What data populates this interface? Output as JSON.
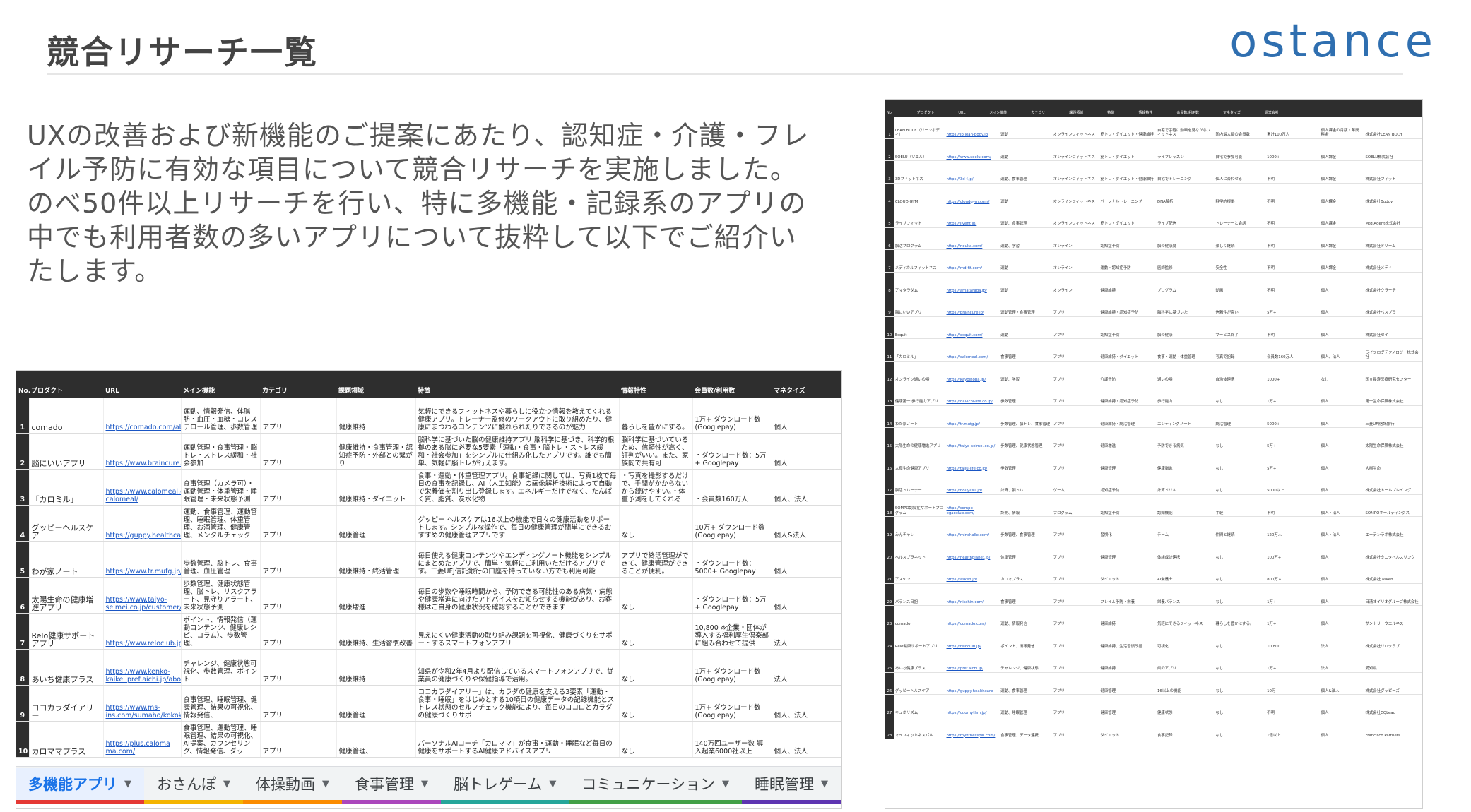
{
  "slide": {
    "title": "競合リサーチ一覧",
    "logo": "ostance",
    "intro_lines": [
      "UXの改善および新機能のご提案にあたり、認知症・介護・フレ",
      "イル予防に有効な項目について競合リサーチを実施しました。",
      "のべ50件以上リサーチを行い、特に多機能・記録系のアプリの",
      "中でも利用者数の多いアプリについて抜粋して以下でご紹介い",
      "たします。"
    ]
  },
  "sheet": {
    "headers": [
      "No.",
      "プロダクト",
      "URL",
      "メイン機能",
      "カテゴリ",
      "課題領域",
      "特徴",
      "情報特性",
      "会員数/利用数",
      "マネタイズ"
    ],
    "rows": [
      {
        "no": "1",
        "product": "comado",
        "url": "https://comado.com/about.app",
        "main": "運動、情報発信、体脂肪・血圧・血糖・コレステロール管理、歩数管理",
        "category": "アプリ",
        "area": "健康維持",
        "feature": "気軽にできるフィットネスや暮らしに役立つ情報を教えてくれる健康アプリ。トレーナー監修のワークアウトに取り組めたり、健康にまつわるコンテンツに触れられたりできるのが魅力",
        "info": "暮らしを豊かにする。",
        "users": "1万+ ダウンロード数 (Googlepay)",
        "money": "個人"
      },
      {
        "no": "2",
        "product": "脳にいいアプリ",
        "url": "https://www.braincure.jp/",
        "main": "運動管理・食事管理・脳トレ・ストレス緩和・社会参加",
        "category": "アプリ",
        "area": "健康維持・食事管理・認知症予防・外部との繋がり",
        "feature": "脳科学に基づいた脳の健康維持アプリ 脳科学に基づき、科学的根拠のある脳に必要な5要素「運動・食事・脳トレ・ストレス緩和・社会参加」をシンプルに仕組み化したアプリです。誰でも簡単、気軽に脳トレが行えます。",
        "info": "脳科学に基づいているため、信頼性が高く、評判がいい。また、家族間で共有可",
        "users": "・ダウンロード数：5万+ Googlepay",
        "money": "個人"
      },
      {
        "no": "3",
        "product": "「カロミル」",
        "url": "https://www.calomeal.com/about-calomeal/",
        "main": "食事管理（カメラ可）・運動管理・体重管理・睡眠管理・未来状態予測",
        "category": "アプリ",
        "area": "健康維持・ダイエット",
        "feature": "食事・運動・体重管理アプリ。食事記録に関しては、写真1枚で毎日の食事を記録し、AI（人工知能）の画像解析技術によって自動で栄養価を割り出し登録します。エネルギーだけでなく、たんぱく質、脂質、炭水化物",
        "info": "・写真を撮影するだけで、手間がかからないから続けやすい。・体重予測をしてくれる",
        "users": "・会員数160万人",
        "money": "個人、法人"
      },
      {
        "no": "4",
        "product": "グッピーヘルスケア",
        "url": "https://guppy.healthcare",
        "main": "運動、食事管理、運動管理、睡眠管理、体重管理、お酒管理、健康管理、メンタルチェック",
        "category": "アプリ",
        "area": "健康管理",
        "feature": "グッピー ヘルスケアは16以上の機能で日々の健康活動をサポートします。シンプルな操作で、毎日の健康管理が簡単にできるおすすめの健康管理アプリです",
        "info": "なし",
        "users": "10万+ ダウンロード数 (Googlepay)",
        "money": "個人&法人"
      },
      {
        "no": "5",
        "product": "わが家ノート",
        "url": "https://www.tr.mufg.jp/ippan/wagayanote/health/",
        "main": "歩数管理、脳トレ、食事管理、血圧管理",
        "category": "アプリ",
        "area": "健康維持・終活管理",
        "feature": "毎日使える健康コンテンツやエンディングノート機能をシンプルにまとめたアプリで、簡単・気軽にご利用いただけるアプリです。三菱UFJ信託銀行の口座を持っていない方でも利用可能",
        "info": "アプリで終活管理ができて、健康管理ができることが便利。",
        "users": "・ダウンロード数：5000+ Googlepay",
        "money": "個人"
      },
      {
        "no": "6",
        "product": "太陽生命の健康増進アプリ",
        "url": "https://www.taiyo-seimei.co.jp/customer/health_promotion/app.html",
        "main": "歩数管理、健康状態管理、脳トレ、リスクアラート、見守りアラート、未来状態予測",
        "category": "アプリ",
        "area": "健康増進",
        "feature": "毎日の歩数や睡眠時間から、予防できる可能性のある病気・病態や健康増進に向けたアドバイスをお知らせする機能があり、お客様はご自身の健康状況を確認することができます",
        "info": "なし",
        "users": "・ダウンロード数：5万+ Googlepay",
        "money": "個人"
      },
      {
        "no": "7",
        "product": "Relo健康サポートアプリ",
        "url": "https://www.reloclub.jp/health/app/",
        "main": "ポイント、情報発信（運動コンテンツ、健康レシピ、コラム）、歩数管理、",
        "category": "アプリ",
        "area": "健康維持、生活習慣改善",
        "feature": "見えにくい健康活動の取り組み課題を可視化、健康づくりをサポートするスマートフォンアプリ",
        "info": "なし",
        "users": "10,800 ※企業・団体が導入する福利厚生倶楽部に組み合わせて提供",
        "money": "法人"
      },
      {
        "no": "8",
        "product": "あいち健康プラス",
        "url": "https://www.kenko-kaikei.pref.aichi.jp/about/app/",
        "main": "チャレンジ、健康状態可視化、歩数管理、ポイント",
        "category": "アプリ",
        "area": "健康維持",
        "feature": "知県が令和2年4月より配信しているスマートフォンアプリで、従業員の健康づくりや保健指導で活用。",
        "info": "なし",
        "users": "1万+ ダウンロード数 (Googlepay)",
        "money": "法人"
      },
      {
        "no": "9",
        "product": "ココカラダイアリー",
        "url": "https://www.ms-ins.com/sumaho/kokokaradiary.html",
        "main": "食事管理、睡眠管理、健康管理、結果の可視化、情報発信、",
        "category": "アプリ",
        "area": "健康管理",
        "feature": "ココカラダイアリー」は、カラダの健康を支える3要素「運動・食事・睡眠」をはじめとする10項目の健康データの記録機能とストレス状態のセルフチェック機能により、毎日のココロとカラダの健康づくりサポ",
        "info": "なし",
        "users": "1万+ ダウンロード数 (Googlepay)",
        "money": "個人、法人"
      },
      {
        "no": "10",
        "product": "カロママプラス",
        "url": "https://plus.caloma ma.com/",
        "main": "食事管理、運動管理、睡眠管理、結果の可視化、AI提案、カウンセリング、情報発信、ダッ",
        "category": "アプリ",
        "area": "健康管理、",
        "feature": "パーソナルAIコーチ「カロママ」が食事・運動・睡眠など毎日の健康をサポートするAI健康アドバイスアプリ",
        "info": "なし",
        "users": "140万回ユーザー数 導入起業6000社以上",
        "money": "個人、法人"
      }
    ]
  },
  "tabs": [
    {
      "label": "多機能アプリ",
      "active": true,
      "color": "#e53935"
    },
    {
      "label": "おさんぽ",
      "active": false,
      "color": "#f4b400"
    },
    {
      "label": "体操動画",
      "active": false,
      "color": "#fb8c00"
    },
    {
      "label": "食事管理",
      "active": false,
      "color": "#ab47bc"
    },
    {
      "label": "脳トレゲーム",
      "active": false,
      "color": "#26a69a"
    },
    {
      "label": "コミュニケーション",
      "active": false,
      "color": "#43a047"
    },
    {
      "label": "睡眠管理",
      "active": false,
      "color": "#5e35b1"
    }
  ],
  "sheet2": {
    "headers": [
      "No.",
      "プロダクト",
      "URL",
      "メイン機能",
      "カテゴリ",
      "課題領域",
      "特徴",
      "情報特性",
      "会員数/利用数",
      "マネタイズ",
      "運営会社"
    ],
    "rows": [
      [
        "1",
        "LEAN BODY（リーンボディ）",
        "https://lp.lean-body.jp",
        "運動",
        "オンラインフィットネス",
        "筋トレ・ダイエット・健康維持",
        "自宅で手軽に動画を見ながらフィットネス",
        "国内最大級の会員数",
        "累計100万人",
        "個人課金の月額・年間料金",
        "株式会社LEAN BODY"
      ],
      [
        "2",
        "SOELU（ソエル）",
        "https://www.soelu.com/",
        "運動",
        "オンラインフィットネス",
        "筋トレ・ダイエット",
        "ライブレッスン",
        "自宅で参加可能",
        "1000+",
        "個人課金",
        "SOELU株式会社"
      ],
      [
        "3",
        "3Dフィットネス",
        "https://3d-f.jp/",
        "運動、食事管理",
        "オンラインフィットネス",
        "筋トレ・ダイエット・健康維持",
        "自宅でトレーニング",
        "個人に合わせる",
        "不明",
        "個人課金",
        "株式会社フィット"
      ],
      [
        "4",
        "CLOUD GYM",
        "https://cloudgym.com/",
        "運動",
        "オンラインフィットネス",
        "パーソナルトレーニング",
        "DNA解析",
        "科学的根拠",
        "不明",
        "個人課金",
        "株式会社Buddy"
      ],
      [
        "5",
        "ライブフィット",
        "https://livefit.jp/",
        "運動、食事管理",
        "オンラインフィットネス",
        "筋トレ・ダイエット",
        "ライブ配信",
        "トレーナーと会話",
        "不明",
        "個人課金",
        "Mtg Agent株式会社"
      ],
      [
        "6",
        "脳活プログラム",
        "https://nouka.com/",
        "運動、学習",
        "オンライン",
        "認知症予防",
        "脳の健康度",
        "楽しく継続",
        "不明",
        "個人課金",
        "株式会社ドリーム"
      ],
      [
        "7",
        "メディカルフィットネス",
        "https://md-fit.com/",
        "運動",
        "オンライン",
        "運動・認知症予防",
        "医師監修",
        "安全性",
        "不明",
        "個人課金",
        "株式会社メディ"
      ],
      [
        "8",
        "アマタラダム",
        "https://amatarada.jp/",
        "運動",
        "オンライン",
        "健康維持",
        "プログラム",
        "動画",
        "不明",
        "個人",
        "株式会社クラーチ"
      ],
      [
        "9",
        "脳にいいアプリ",
        "https://braincure.jp/",
        "運動管理・食事管理",
        "アプリ",
        "健康維持・認知症予防",
        "脳科学に基づいた",
        "信頼性が高い",
        "5万+",
        "個人",
        "株式会社ベスプラ"
      ],
      [
        "10",
        "Esquit",
        "https://esquit.com/",
        "運動",
        "アプリ",
        "認知症予防",
        "脳の健康",
        "サービス終了",
        "不明",
        "個人",
        "株式会社セイ"
      ],
      [
        "11",
        "「カロミル」",
        "https://calomeal.com/",
        "食事管理",
        "アプリ",
        "健康維持・ダイエット",
        "食事・運動・体重管理",
        "写真で記録",
        "会員数160万人",
        "個人、法人",
        "ライフログテクノロジー株式会社"
      ],
      [
        "12",
        "オンライン通いの場",
        "https://kayoinoba.jp/",
        "運動、学習",
        "アプリ",
        "介護予防",
        "通いの場",
        "自治体連携",
        "1000+",
        "なし",
        "国立長寿医療研究センター"
      ],
      [
        "13",
        "健康第一 歩行能力アプリ",
        "https://dai-ichi-life.co.jp/",
        "歩数管理",
        "アプリ",
        "健康維持・認知症予防",
        "歩行能力",
        "なし",
        "1万+",
        "個人",
        "第一生命保険株式会社"
      ],
      [
        "14",
        "わが家ノート",
        "https://tr.mufg.jp/",
        "歩数管理、脳トレ、食事管理",
        "アプリ",
        "健康維持・終活管理",
        "エンディングノート",
        "終活管理",
        "5000+",
        "個人",
        "三菱UFJ信託銀行"
      ],
      [
        "15",
        "太陽生命の健康増進アプリ",
        "https://taiyo-seimei.co.jp/",
        "歩数管理、健康状態管理",
        "アプリ",
        "健康増進",
        "予防できる病気",
        "なし",
        "5万+",
        "個人",
        "太陽生命保険株式会社"
      ],
      [
        "16",
        "大樹生命健康アプリ",
        "https://taiju-life.co.jp/",
        "歩数管理",
        "アプリ",
        "健康管理",
        "健康増進",
        "なし",
        "5万+",
        "個人",
        "大樹生命"
      ],
      [
        "17",
        "脳活トレーナー",
        "https://nouyasu.jp/",
        "計算、脳トレ",
        "ゲーム",
        "認知症予防",
        "計算ドリル",
        "なし",
        "5000以上",
        "個人",
        "株式会社トールプレイング"
      ],
      [
        "18",
        "SOMPO認知症サポートプログラム",
        "https://sompo-egaoclub.com/",
        "計測、情報",
        "プログラム",
        "認知症予防",
        "認知機能",
        "手軽",
        "不明",
        "個人・法人",
        "SOMPOホールディングス"
      ],
      [
        "19",
        "みんチャレ",
        "https://minchalle.com/",
        "歩数管理、食事管理",
        "アプリ",
        "習慣化",
        "チーム",
        "仲間と継続",
        "120万人",
        "個人・法人",
        "エーテンラボ株式会社"
      ],
      [
        "20",
        "ヘルスプラネット",
        "https://healthplanet.jp/",
        "体重管理",
        "アプリ",
        "健康管理",
        "体組成計連携",
        "なし",
        "100万+",
        "個人",
        "株式会社タニタヘルスリンク"
      ],
      [
        "21",
        "アスケン",
        "https://asken.jp/",
        "カロマプラス",
        "アプリ",
        "ダイエット",
        "AI栄養士",
        "なし",
        "800万人",
        "個人",
        "株式会社 asken"
      ],
      [
        "22",
        "バランス日記",
        "https://nisshin.com/",
        "食事管理",
        "アプリ",
        "フレイル予防・栄養",
        "栄養バランス",
        "なし",
        "1万+",
        "個人",
        "日清オイリオグループ株式会社"
      ],
      [
        "23",
        "comado",
        "https://comado.com/",
        "運動、情報発信",
        "アプリ",
        "健康維持",
        "気軽にできるフィットネス",
        "暮らしを豊かにする。",
        "1万+",
        "個人",
        "サントリーウエルネス"
      ],
      [
        "24",
        "Relo健康サポートアプリ",
        "https://reloclub.jp/",
        "ポイント、情報発信",
        "アプリ",
        "健康維持、生活習慣改善",
        "可視化",
        "なし",
        "10,800",
        "法人",
        "株式会社リロクラブ"
      ],
      [
        "25",
        "あいち健康プラス",
        "https://pref.aichi.jp/",
        "チャレンジ、健康状態",
        "アプリ",
        "健康維持",
        "県のアプリ",
        "なし",
        "1万+",
        "法人",
        "愛知県"
      ],
      [
        "26",
        "グッピーヘルスケア",
        "https://guppy.healthcare",
        "運動、食事管理",
        "アプリ",
        "健康管理",
        "16以上の機能",
        "なし",
        "10万+",
        "個人&法人",
        "株式会社グッピーズ"
      ],
      [
        "27",
        "キュオリズム",
        "https://cuorhythm.jp/",
        "運動、睡眠管理",
        "アプリ",
        "健康管理",
        "健康状態",
        "なし",
        "不明",
        "個人",
        "株式会社CQLead"
      ],
      [
        "28",
        "マイフィットネスパル",
        "https://myfitnesspal.com/",
        "食事管理、データ連携",
        "アプリ",
        "ダイエット",
        "食事記録",
        "なし",
        "1億以上",
        "個人",
        "Francisco Partners"
      ]
    ]
  }
}
